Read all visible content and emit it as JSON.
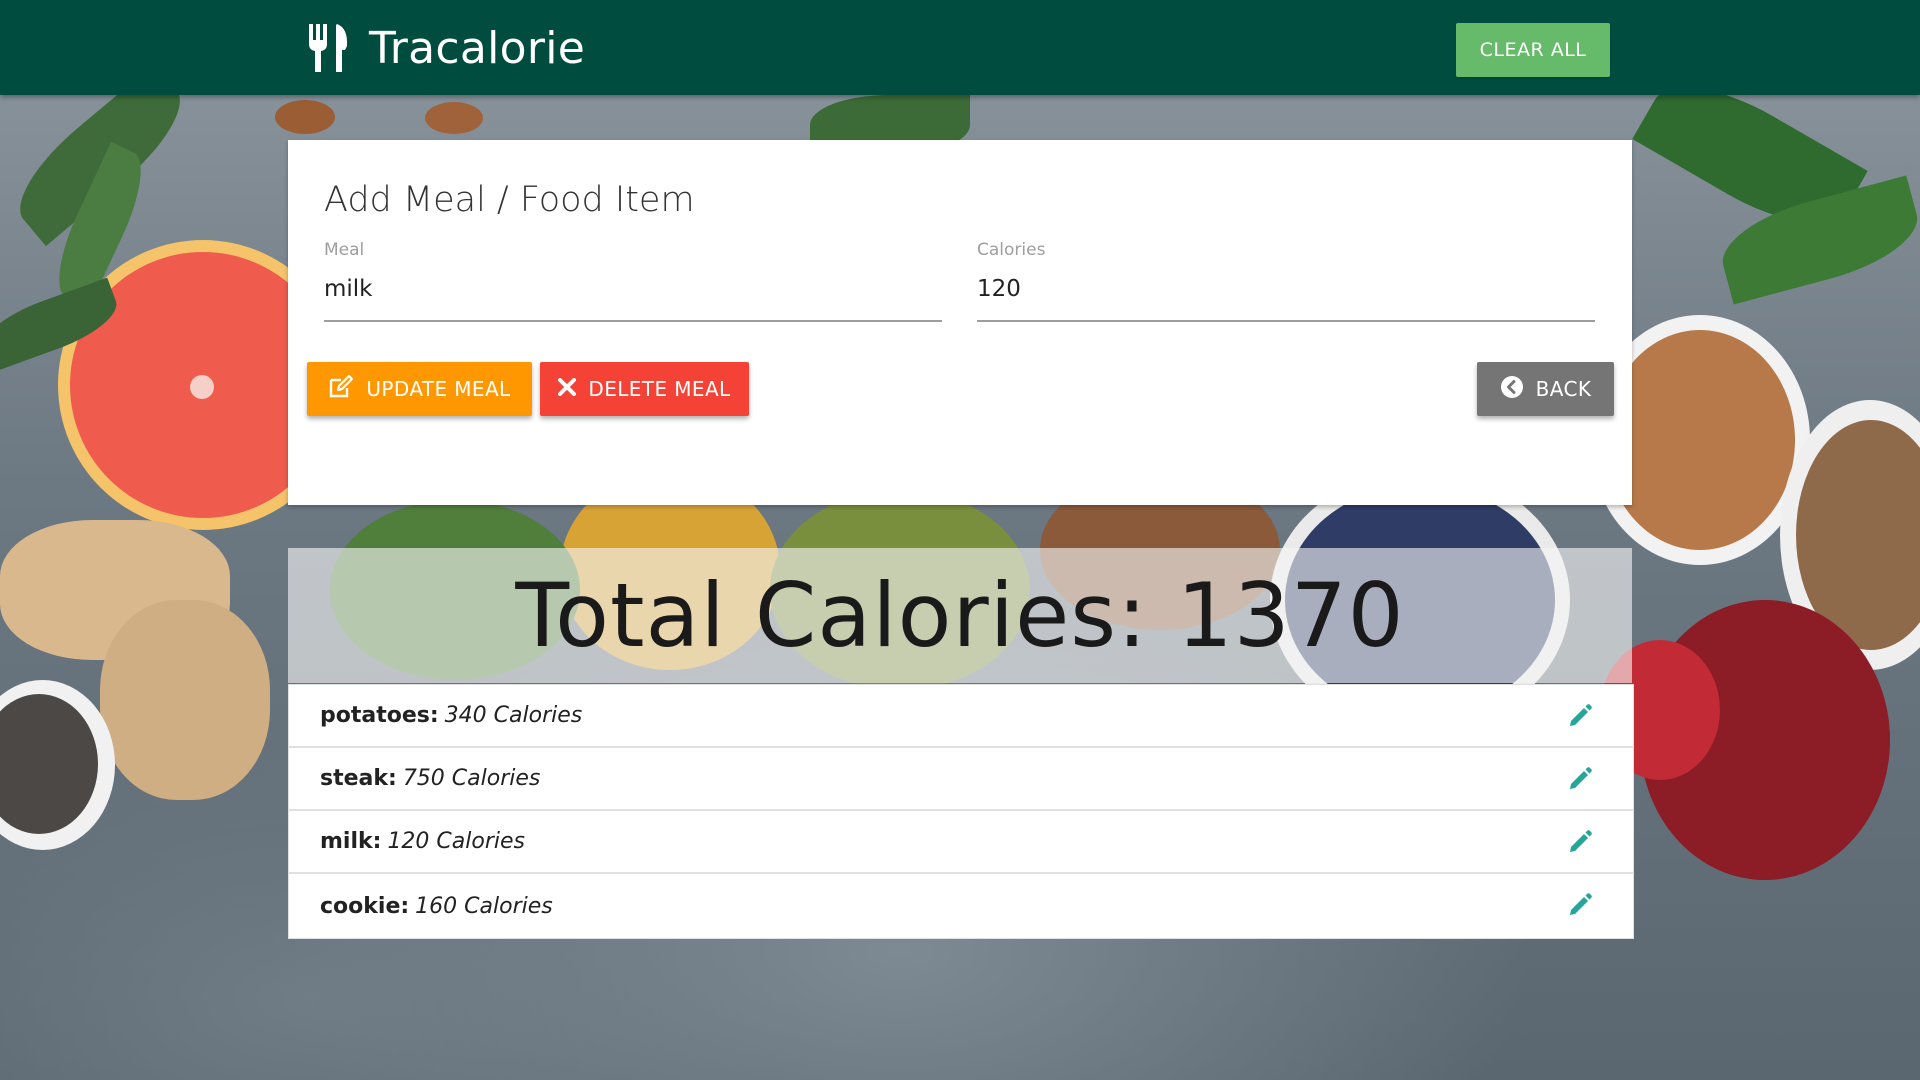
{
  "navbar": {
    "brand": "Tracalorie",
    "brand_icon": "utensils-icon",
    "clear_all_label": "CLEAR ALL"
  },
  "form": {
    "title": "Add Meal / Food Item",
    "meal": {
      "label": "Meal",
      "value": "milk"
    },
    "calories": {
      "label": "Calories",
      "value": "120"
    },
    "buttons": {
      "update": "UPDATE MEAL",
      "delete": "DELETE MEAL",
      "back": "BACK"
    }
  },
  "total": {
    "text": "Total Calories: 1370"
  },
  "items": [
    {
      "name": "potatoes:",
      "calories": "340 Calories"
    },
    {
      "name": "steak:",
      "calories": "750 Calories"
    },
    {
      "name": "milk:",
      "calories": "120 Calories"
    },
    {
      "name": "cookie:",
      "calories": "160 Calories"
    }
  ],
  "colors": {
    "navbar": "#004d40",
    "clear_all": "#66bb6a",
    "update": "#ff9800",
    "delete": "#f44336",
    "back": "#757575",
    "edit_icon": "#26a69a"
  }
}
